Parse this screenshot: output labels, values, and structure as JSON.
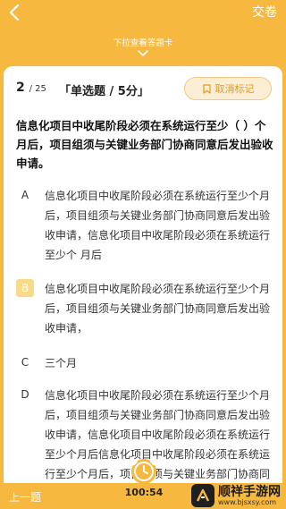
{
  "header": {
    "submit_label": "交卷",
    "drawer_hint": "下拉查看答题卡"
  },
  "question": {
    "index": "2",
    "total": "/ 25",
    "type_label": "「单选题 / 5分」",
    "mark_label": "取消标记",
    "stem": "信息化项目中收尾阶段必须在系统运行至少（  ）个月后，项目组须与关键业务部门协商同意后发出验收申请。",
    "options": [
      {
        "letter": "A",
        "text": "信息化项目中收尾阶段必须在系统运行至少个月后，项目组须与关键业务部门协商同意后发出验收申请，信息化项目中收尾阶段必须在系统运行至少个 月后",
        "selected": false
      },
      {
        "letter": "B",
        "text": "信息化项目中收尾阶段必须在系统运行至少个月后，项目组须与关键业务部门协商同意后发出验收申请，",
        "selected": true
      },
      {
        "letter": "C",
        "text": "三个月",
        "selected": false
      },
      {
        "letter": "D",
        "text": "信息化项目中收尾阶段必须在系统运行至少个月后，项目组须与关键业务部门协商同意后发出验收申请，信息化项目中收尾阶段必须在系统运行至少个月后信息化项目中收尾阶段必须在系统运行至少个月后，项目组须与关键业务部门协商同意后发出验收申请。",
        "selected": false
      }
    ]
  },
  "footer": {
    "prev_label": "上一题",
    "timer": "100:54"
  },
  "watermark": {
    "title": "顺祥手游网",
    "url": "www.bjsxsy.com"
  },
  "colors": {
    "accent": "#f7b840",
    "selected_option": "#fbd98a",
    "mark_text": "#e39a1e"
  }
}
